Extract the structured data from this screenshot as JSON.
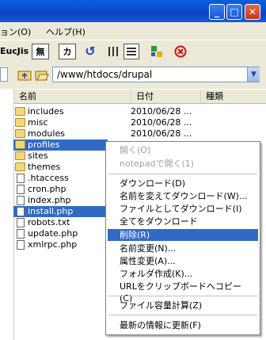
{
  "menubar": {
    "items": [
      "ョン(O)",
      "ヘルプ(H)"
    ]
  },
  "toolbar": {
    "labels": [
      "Euc",
      "Jis",
      "無",
      "カナ"
    ]
  },
  "address": {
    "value": "/www/htdocs/drupal"
  },
  "columns": {
    "name": "名前",
    "date": "日付",
    "type": "種類"
  },
  "files": [
    {
      "name": "includes",
      "date": "2010/06/28 ...",
      "kind": "folder"
    },
    {
      "name": "misc",
      "date": "2010/06/28 ...",
      "kind": "folder"
    },
    {
      "name": "modules",
      "date": "2010/06/28 ...",
      "kind": "folder"
    },
    {
      "name": "profiles",
      "date": "2010/06/28",
      "kind": "folder",
      "selected": true
    },
    {
      "name": "sites",
      "date": "",
      "kind": "folder"
    },
    {
      "name": "themes",
      "date": "",
      "kind": "folder"
    },
    {
      "name": ".htaccess",
      "date": "",
      "kind": "file"
    },
    {
      "name": "cron.php",
      "date": "",
      "kind": "file"
    },
    {
      "name": "index.php",
      "date": "",
      "kind": "file"
    },
    {
      "name": "install.php",
      "date": "",
      "kind": "file",
      "selected": true
    },
    {
      "name": "robots.txt",
      "date": "",
      "kind": "file"
    },
    {
      "name": "update.php",
      "date": "",
      "kind": "file"
    },
    {
      "name": "xmlrpc.php",
      "date": "",
      "kind": "file"
    }
  ],
  "context_menu": {
    "open": "開く(O)",
    "open_notepad": "notepadで開く(1)",
    "download": "ダウンロード(D)",
    "rename_download": "名前を変えてダウンロード(W)...",
    "download_as_file": "ファイルとしてダウンロード(I)",
    "download_all": "全てをダウンロード",
    "delete": "削除(R)",
    "rename": "名前変更(N)...",
    "attributes": "属性変更(A)...",
    "new_folder": "フォルダ作成(K)...",
    "copy_url": "URLをクリップボードへコピー(C)",
    "calc_size": "ファイル容量計算(Z)",
    "refresh": "最新の情報に更新(F)"
  }
}
